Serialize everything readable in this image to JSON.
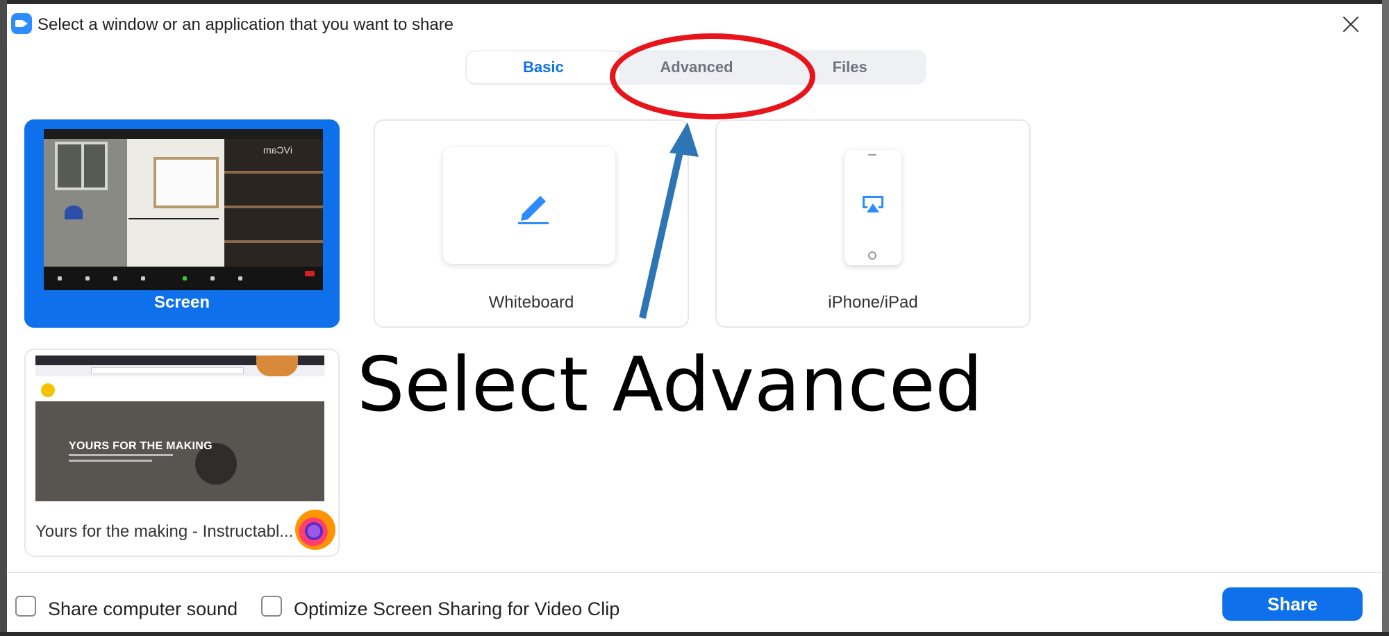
{
  "window": {
    "title": "Select a window or an application that you want to share"
  },
  "tabs": [
    {
      "label": "Basic",
      "active": true
    },
    {
      "label": "Advanced",
      "active": false
    },
    {
      "label": "Files",
      "active": false
    }
  ],
  "tiles": {
    "screen": {
      "label": "Screen",
      "selected": true,
      "thumb_watermark": "iVCam"
    },
    "whiteboard": {
      "label": "Whiteboard"
    },
    "iphone": {
      "label": "iPhone/iPad"
    },
    "browser": {
      "label": "Yours for the making - Instructabl...",
      "thumb_headline": "YOURS FOR THE MAKING"
    }
  },
  "annotation": {
    "text": "Select Advanced",
    "ellipse_color": "#e8141b",
    "arrow_color": "#2e75b6"
  },
  "footer": {
    "share_sound_label": "Share computer sound",
    "share_sound_checked": false,
    "optimize_label": "Optimize Screen Sharing for Video Clip",
    "optimize_checked": false,
    "share_button_label": "Share"
  },
  "colors": {
    "accent": "#0e71eb",
    "app_icon": "#2d8cff"
  },
  "icons": {
    "app": "zoom-camera-icon",
    "close": "close-icon",
    "whiteboard": "pen-icon",
    "iphone": "airplay-icon",
    "browser": "firefox-icon"
  }
}
